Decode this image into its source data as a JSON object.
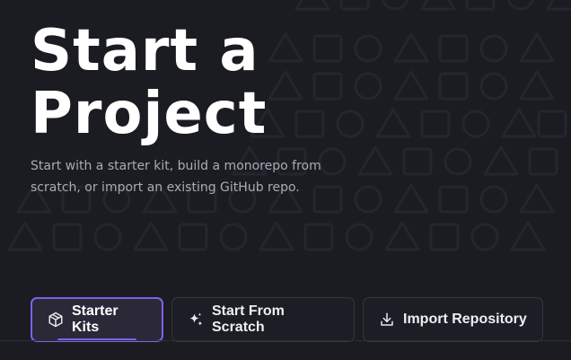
{
  "hero": {
    "title_line1": "Start a",
    "title_line2": "Project",
    "subtitle": "Start with a starter kit, build a monorepo from scratch, or import an existing GitHub repo."
  },
  "tabs": [
    {
      "label": "Starter Kits",
      "icon": "box-icon",
      "active": true
    },
    {
      "label": "Start From Scratch",
      "icon": "sparkles-icon",
      "active": false
    },
    {
      "label": "Import Repository",
      "icon": "download-icon",
      "active": false
    }
  ],
  "colors": {
    "background": "#1b1c22",
    "accent": "#7c62e8",
    "subtitle": "#a9abb5"
  }
}
